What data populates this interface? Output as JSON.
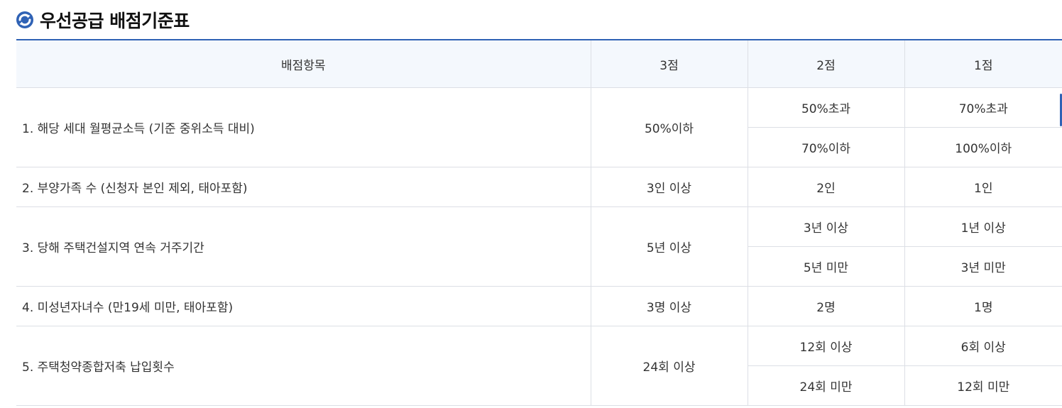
{
  "title": "우선공급 배점기준표",
  "headers": [
    "배점항목",
    "3점",
    "2점",
    "1점"
  ],
  "rows": [
    {
      "item": "1. 해당 세대 월평균소득 (기준 중위소득 대비)",
      "score3": "50%이하",
      "score2": [
        "50%초과",
        "70%이하"
      ],
      "score1": [
        "70%초과",
        "100%이하"
      ]
    },
    {
      "item": "2. 부양가족 수 (신청자 본인 제외, 태아포함)",
      "score3": "3인 이상",
      "score2": [
        "2인"
      ],
      "score1": [
        "1인"
      ]
    },
    {
      "item": "3. 당해 주택건설지역 연속 거주기간",
      "score3": "5년 이상",
      "score2": [
        "3년 이상",
        "5년 미만"
      ],
      "score1": [
        "1년 이상",
        "3년 미만"
      ]
    },
    {
      "item": "4. 미성년자녀수 (만19세 미만, 태아포함)",
      "score3": "3명 이상",
      "score2": [
        "2명"
      ],
      "score1": [
        "1명"
      ]
    },
    {
      "item": "5. 주택청약종합저축 납입횟수",
      "score3": "24회 이상",
      "score2": [
        "12회 이상",
        "24회 미만"
      ],
      "score1": [
        "6회 이상",
        "12회 미만"
      ]
    }
  ],
  "colors": {
    "accent": "#2f62b5",
    "header_bg": "#f4f8fd",
    "border": "#dcdfe5"
  }
}
